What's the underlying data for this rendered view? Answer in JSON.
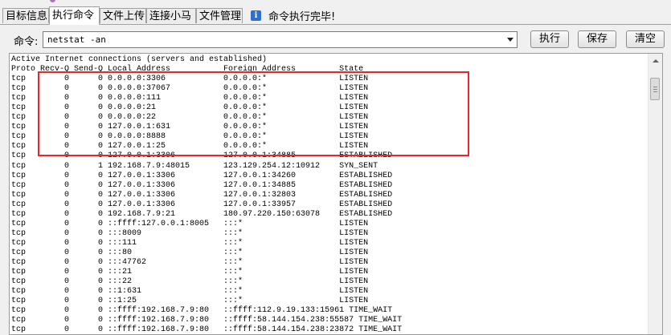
{
  "tabs": [
    {
      "label": "目标信息",
      "active": false
    },
    {
      "label": "执行命令",
      "active": true
    },
    {
      "label": "文件上传",
      "active": false
    },
    {
      "label": "连接小马",
      "active": false
    },
    {
      "label": "文件管理",
      "active": false
    }
  ],
  "status": {
    "icon": "info-icon",
    "text": "命令执行完毕!"
  },
  "command": {
    "label": "命令:",
    "value": "netstat -an"
  },
  "buttons": {
    "execute": "执行",
    "save": "保存",
    "clear": "清空"
  },
  "output": {
    "lines": [
      "Active Internet connections (servers and established)",
      "Proto Recv-Q Send-Q Local Address           Foreign Address         State",
      "tcp        0      0 0.0.0.0:3306            0.0.0.0:*               LISTEN",
      "tcp        0      0 0.0.0.0:37067           0.0.0.0:*               LISTEN",
      "tcp        0      0 0.0.0.0:111             0.0.0.0:*               LISTEN",
      "tcp        0      0 0.0.0.0:21              0.0.0.0:*               LISTEN",
      "tcp        0      0 0.0.0.0:22              0.0.0.0:*               LISTEN",
      "tcp        0      0 127.0.0.1:631           0.0.0.0:*               LISTEN",
      "tcp        0      0 0.0.0.0:8888            0.0.0.0:*               LISTEN",
      "tcp        0      0 127.0.0.1:25            0.0.0.0:*               LISTEN",
      "tcp        0      0 127.0.0.1:3306          127.0.0.1:34885         ESTABLISHED",
      "tcp        0      1 192.168.7.9:48015       123.129.254.12:10912    SYN_SENT",
      "tcp        0      0 127.0.0.1:3306          127.0.0.1:34260         ESTABLISHED",
      "tcp        0      0 127.0.0.1:3306          127.0.0.1:34885         ESTABLISHED",
      "tcp        0      0 127.0.0.1:3306          127.0.0.1:32803         ESTABLISHED",
      "tcp        0      0 127.0.0.1:3306          127.0.0.1:33957         ESTABLISHED",
      "tcp        0      0 192.168.7.9:21          180.97.220.150:63078    ESTABLISHED",
      "tcp        0      0 ::ffff:127.0.0.1:8005   :::*                    LISTEN",
      "tcp        0      0 :::8009                 :::*                    LISTEN",
      "tcp        0      0 :::111                  :::*                    LISTEN",
      "tcp        0      0 :::80                   :::*                    LISTEN",
      "tcp        0      0 :::47762                :::*                    LISTEN",
      "tcp        0      0 :::21                   :::*                    LISTEN",
      "tcp        0      0 :::22                   :::*                    LISTEN",
      "tcp        0      0 ::1:631                 :::*                    LISTEN",
      "tcp        0      0 ::1:25                  :::*                    LISTEN",
      "tcp        0      0 ::ffff:192.168.7.9:80   ::ffff:112.9.19.133:15961 TIME_WAIT",
      "tcp        0      0 ::ffff:192.168.7.9:80   ::ffff:58.144.154.238:55587 TIME_WAIT",
      "tcp        0      0 ::ffff:192.168.7.9:80   ::ffff:58.144.154.238:23872 TIME_WAIT"
    ]
  },
  "colors": {
    "highlight": "#e8262b",
    "tab_active_bg": "#ffffff",
    "info_icon": "#2f6fd0"
  }
}
